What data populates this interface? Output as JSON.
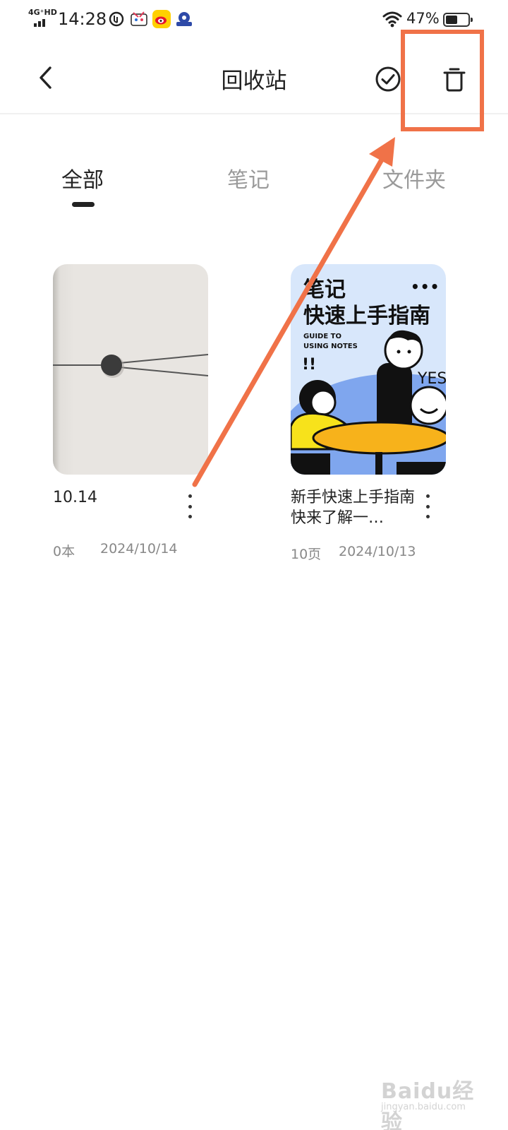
{
  "status_bar": {
    "network": "4G⁺HD",
    "time": "14:28",
    "battery_percent": "47%",
    "icons": [
      "data-saver-icon",
      "video-app-icon",
      "weibo-icon",
      "news-app-icon",
      "wifi-icon",
      "battery-icon"
    ]
  },
  "header": {
    "title": "回收站",
    "back_icon": "chevron-left-icon",
    "select_icon": "check-circle-icon",
    "delete_icon": "trash-icon"
  },
  "tabs": [
    {
      "label": "全部",
      "active": true
    },
    {
      "label": "笔记",
      "active": false
    },
    {
      "label": "文件夹",
      "active": false
    }
  ],
  "items": [
    {
      "title": "10.14",
      "count": "0本",
      "date": "2024/10/14",
      "cover": "folder-cover"
    },
    {
      "title": "新手快速上手指南快来了解一…",
      "count": "10页",
      "date": "2024/10/13",
      "cover": {
        "headline_1": "笔记",
        "headline_2": "快速上手指南",
        "subtitle_1": "GUIDE TO",
        "subtitle_2": "USING NOTES",
        "dots": "•••",
        "exclaim": "!!",
        "yes": "YES"
      }
    }
  ],
  "annotation": {
    "color": "#f07248"
  },
  "watermark": {
    "logo": "Baidu经验",
    "url": "jingyan.baidu.com"
  }
}
